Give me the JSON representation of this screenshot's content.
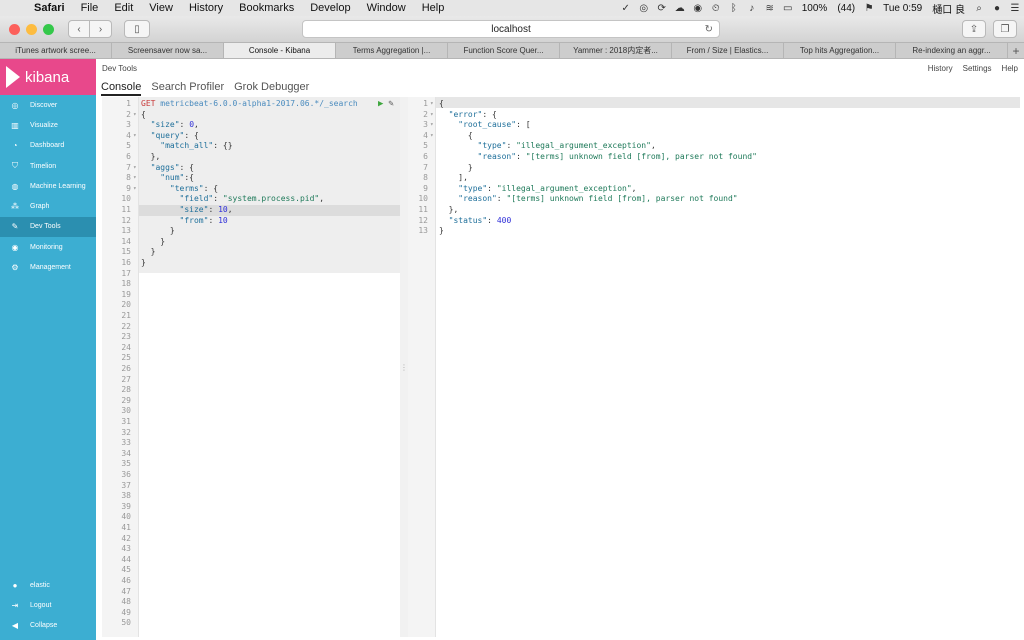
{
  "menubar": {
    "app": "Safari",
    "items": [
      "File",
      "Edit",
      "View",
      "History",
      "Bookmarks",
      "Develop",
      "Window",
      "Help"
    ],
    "battery": "100%",
    "battery_detail": "(44)",
    "clock": "Tue 0:59",
    "user": "樋口 良"
  },
  "toolbar": {
    "address": "localhost"
  },
  "tabs": [
    {
      "label": "iTunes artwork scree..."
    },
    {
      "label": "Screensaver now sa..."
    },
    {
      "label": "Console - Kibana"
    },
    {
      "label": "Terms Aggregation |..."
    },
    {
      "label": "Function Score Quer..."
    },
    {
      "label": "Yammer : 2018内定者..."
    },
    {
      "label": "From / Size | Elastics..."
    },
    {
      "label": "Top hits Aggregation..."
    },
    {
      "label": "Re-indexing an aggr..."
    }
  ],
  "sidebar": {
    "brand": "kibana",
    "items": [
      {
        "label": "Discover",
        "icon": "compass-icon"
      },
      {
        "label": "Visualize",
        "icon": "bar-chart-icon"
      },
      {
        "label": "Dashboard",
        "icon": "dashboard-icon"
      },
      {
        "label": "Timelion",
        "icon": "shield-icon"
      },
      {
        "label": "Machine Learning",
        "icon": "ml-icon"
      },
      {
        "label": "Graph",
        "icon": "graph-icon"
      },
      {
        "label": "Dev Tools",
        "icon": "wrench-icon"
      },
      {
        "label": "Monitoring",
        "icon": "eye-icon"
      },
      {
        "label": "Management",
        "icon": "gear-icon"
      }
    ],
    "bottom": [
      {
        "label": "elastic",
        "icon": "user-icon"
      },
      {
        "label": "Logout",
        "icon": "logout-icon"
      },
      {
        "label": "Collapse",
        "icon": "collapse-icon"
      }
    ]
  },
  "main": {
    "title": "Dev Tools",
    "links": [
      "History",
      "Settings",
      "Help"
    ],
    "subtabs": [
      "Console",
      "Search Profiler",
      "Grok Debugger"
    ]
  },
  "request": {
    "method": "GET",
    "url": "metricbeat-6.0.0-alpha1-2017.06.*/_search",
    "total_lines": 50,
    "highlight_line": 11,
    "lines": [
      [
        [
          "GET ",
          "method"
        ],
        [
          "metricbeat-6.0.0-alpha1-2017.06.*/_search",
          "url"
        ]
      ],
      [
        [
          "{",
          "p"
        ]
      ],
      [
        [
          "  ",
          "p"
        ],
        [
          "\"size\"",
          "key"
        ],
        [
          ": ",
          "p"
        ],
        [
          "0",
          "num"
        ],
        [
          ",",
          "p"
        ]
      ],
      [
        [
          "  ",
          "p"
        ],
        [
          "\"query\"",
          "key"
        ],
        [
          ": {",
          "p"
        ]
      ],
      [
        [
          "    ",
          "p"
        ],
        [
          "\"match_all\"",
          "key"
        ],
        [
          ": {}",
          "p"
        ]
      ],
      [
        [
          "  },",
          "p"
        ]
      ],
      [
        [
          "  ",
          "p"
        ],
        [
          "\"aggs\"",
          "key"
        ],
        [
          ": {",
          "p"
        ]
      ],
      [
        [
          "    ",
          "p"
        ],
        [
          "\"num\"",
          "key"
        ],
        [
          ":{",
          "p"
        ]
      ],
      [
        [
          "      ",
          "p"
        ],
        [
          "\"terms\"",
          "key"
        ],
        [
          ": {",
          "p"
        ]
      ],
      [
        [
          "        ",
          "p"
        ],
        [
          "\"field\"",
          "key"
        ],
        [
          ": ",
          "p"
        ],
        [
          "\"system.process.pid\"",
          "str"
        ],
        [
          ",",
          "p"
        ]
      ],
      [
        [
          "        ",
          "p"
        ],
        [
          "\"size\"",
          "key"
        ],
        [
          ": ",
          "p"
        ],
        [
          "10",
          "num"
        ],
        [
          ",",
          "p"
        ]
      ],
      [
        [
          "        ",
          "p"
        ],
        [
          "\"from\"",
          "key"
        ],
        [
          ": ",
          "p"
        ],
        [
          "10",
          "num"
        ]
      ],
      [
        [
          "      }",
          "p"
        ]
      ],
      [
        [
          "    }",
          "p"
        ]
      ],
      [
        [
          "  }",
          "p"
        ]
      ],
      [
        [
          "}",
          "p"
        ]
      ]
    ]
  },
  "response": {
    "lines": [
      [
        [
          "{",
          "p"
        ]
      ],
      [
        [
          "  ",
          "p"
        ],
        [
          "\"error\"",
          "key"
        ],
        [
          ": {",
          "p"
        ]
      ],
      [
        [
          "    ",
          "p"
        ],
        [
          "\"root_cause\"",
          "key"
        ],
        [
          ": [",
          "p"
        ]
      ],
      [
        [
          "      {",
          "p"
        ]
      ],
      [
        [
          "        ",
          "p"
        ],
        [
          "\"type\"",
          "key"
        ],
        [
          ": ",
          "p"
        ],
        [
          "\"illegal_argument_exception\"",
          "str"
        ],
        [
          ",",
          "p"
        ]
      ],
      [
        [
          "        ",
          "p"
        ],
        [
          "\"reason\"",
          "key"
        ],
        [
          ": ",
          "p"
        ],
        [
          "\"[terms] unknown field [from], parser not found\"",
          "str"
        ]
      ],
      [
        [
          "      }",
          "p"
        ]
      ],
      [
        [
          "    ],",
          "p"
        ]
      ],
      [
        [
          "    ",
          "p"
        ],
        [
          "\"type\"",
          "key"
        ],
        [
          ": ",
          "p"
        ],
        [
          "\"illegal_argument_exception\"",
          "str"
        ],
        [
          ",",
          "p"
        ]
      ],
      [
        [
          "    ",
          "p"
        ],
        [
          "\"reason\"",
          "key"
        ],
        [
          ": ",
          "p"
        ],
        [
          "\"[terms] unknown field [from], parser not found\"",
          "str"
        ]
      ],
      [
        [
          "  },",
          "p"
        ]
      ],
      [
        [
          "  ",
          "p"
        ],
        [
          "\"status\"",
          "key"
        ],
        [
          ": ",
          "p"
        ],
        [
          "400",
          "num"
        ]
      ],
      [
        [
          "}",
          "p"
        ]
      ]
    ]
  },
  "colors": {
    "sidebar": "#3caed2",
    "brand": "#e8488b",
    "active_nav": "#2b8fb0"
  }
}
